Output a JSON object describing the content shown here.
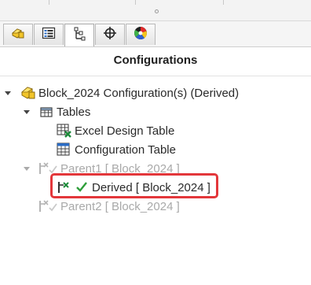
{
  "panel": {
    "title": "Configurations"
  },
  "tabs": [
    {
      "name": "feature-manager",
      "icon": "part-icon"
    },
    {
      "name": "property-manager",
      "icon": "property-list-icon"
    },
    {
      "name": "configuration-manager",
      "icon": "configuration-manager-icon",
      "active": true
    },
    {
      "name": "dimxpert-manager",
      "icon": "crosshair-icon"
    },
    {
      "name": "display-manager",
      "icon": "appearance-sphere-icon"
    }
  ],
  "tree": {
    "root": {
      "label": "Block_2024 Configuration(s)  (Derived)",
      "icon": "part-icon",
      "expanded": true
    },
    "tables": {
      "label": "Tables",
      "icon": "table-folder-icon",
      "expanded": true,
      "items": [
        {
          "label": "Excel Design Table",
          "icon": "excel-design-table-icon"
        },
        {
          "label": "Configuration Table",
          "icon": "configuration-table-icon"
        }
      ]
    },
    "parent1": {
      "label": "Parent1 [ Block_2024 ]",
      "icon": "derived-config-icon",
      "state": "inactive",
      "expanded": true
    },
    "derived": {
      "label": "Derived [ Block_2024 ]",
      "icon": "derived-config-icon",
      "state": "active",
      "highlighted": true
    },
    "parent2": {
      "label": "Parent2 [ Block_2024 ]",
      "icon": "derived-config-icon",
      "state": "inactive"
    }
  },
  "colors": {
    "callout": "#e3373b",
    "active-check": "#2e9e3a",
    "inactive-text": "#a9a9a9"
  }
}
